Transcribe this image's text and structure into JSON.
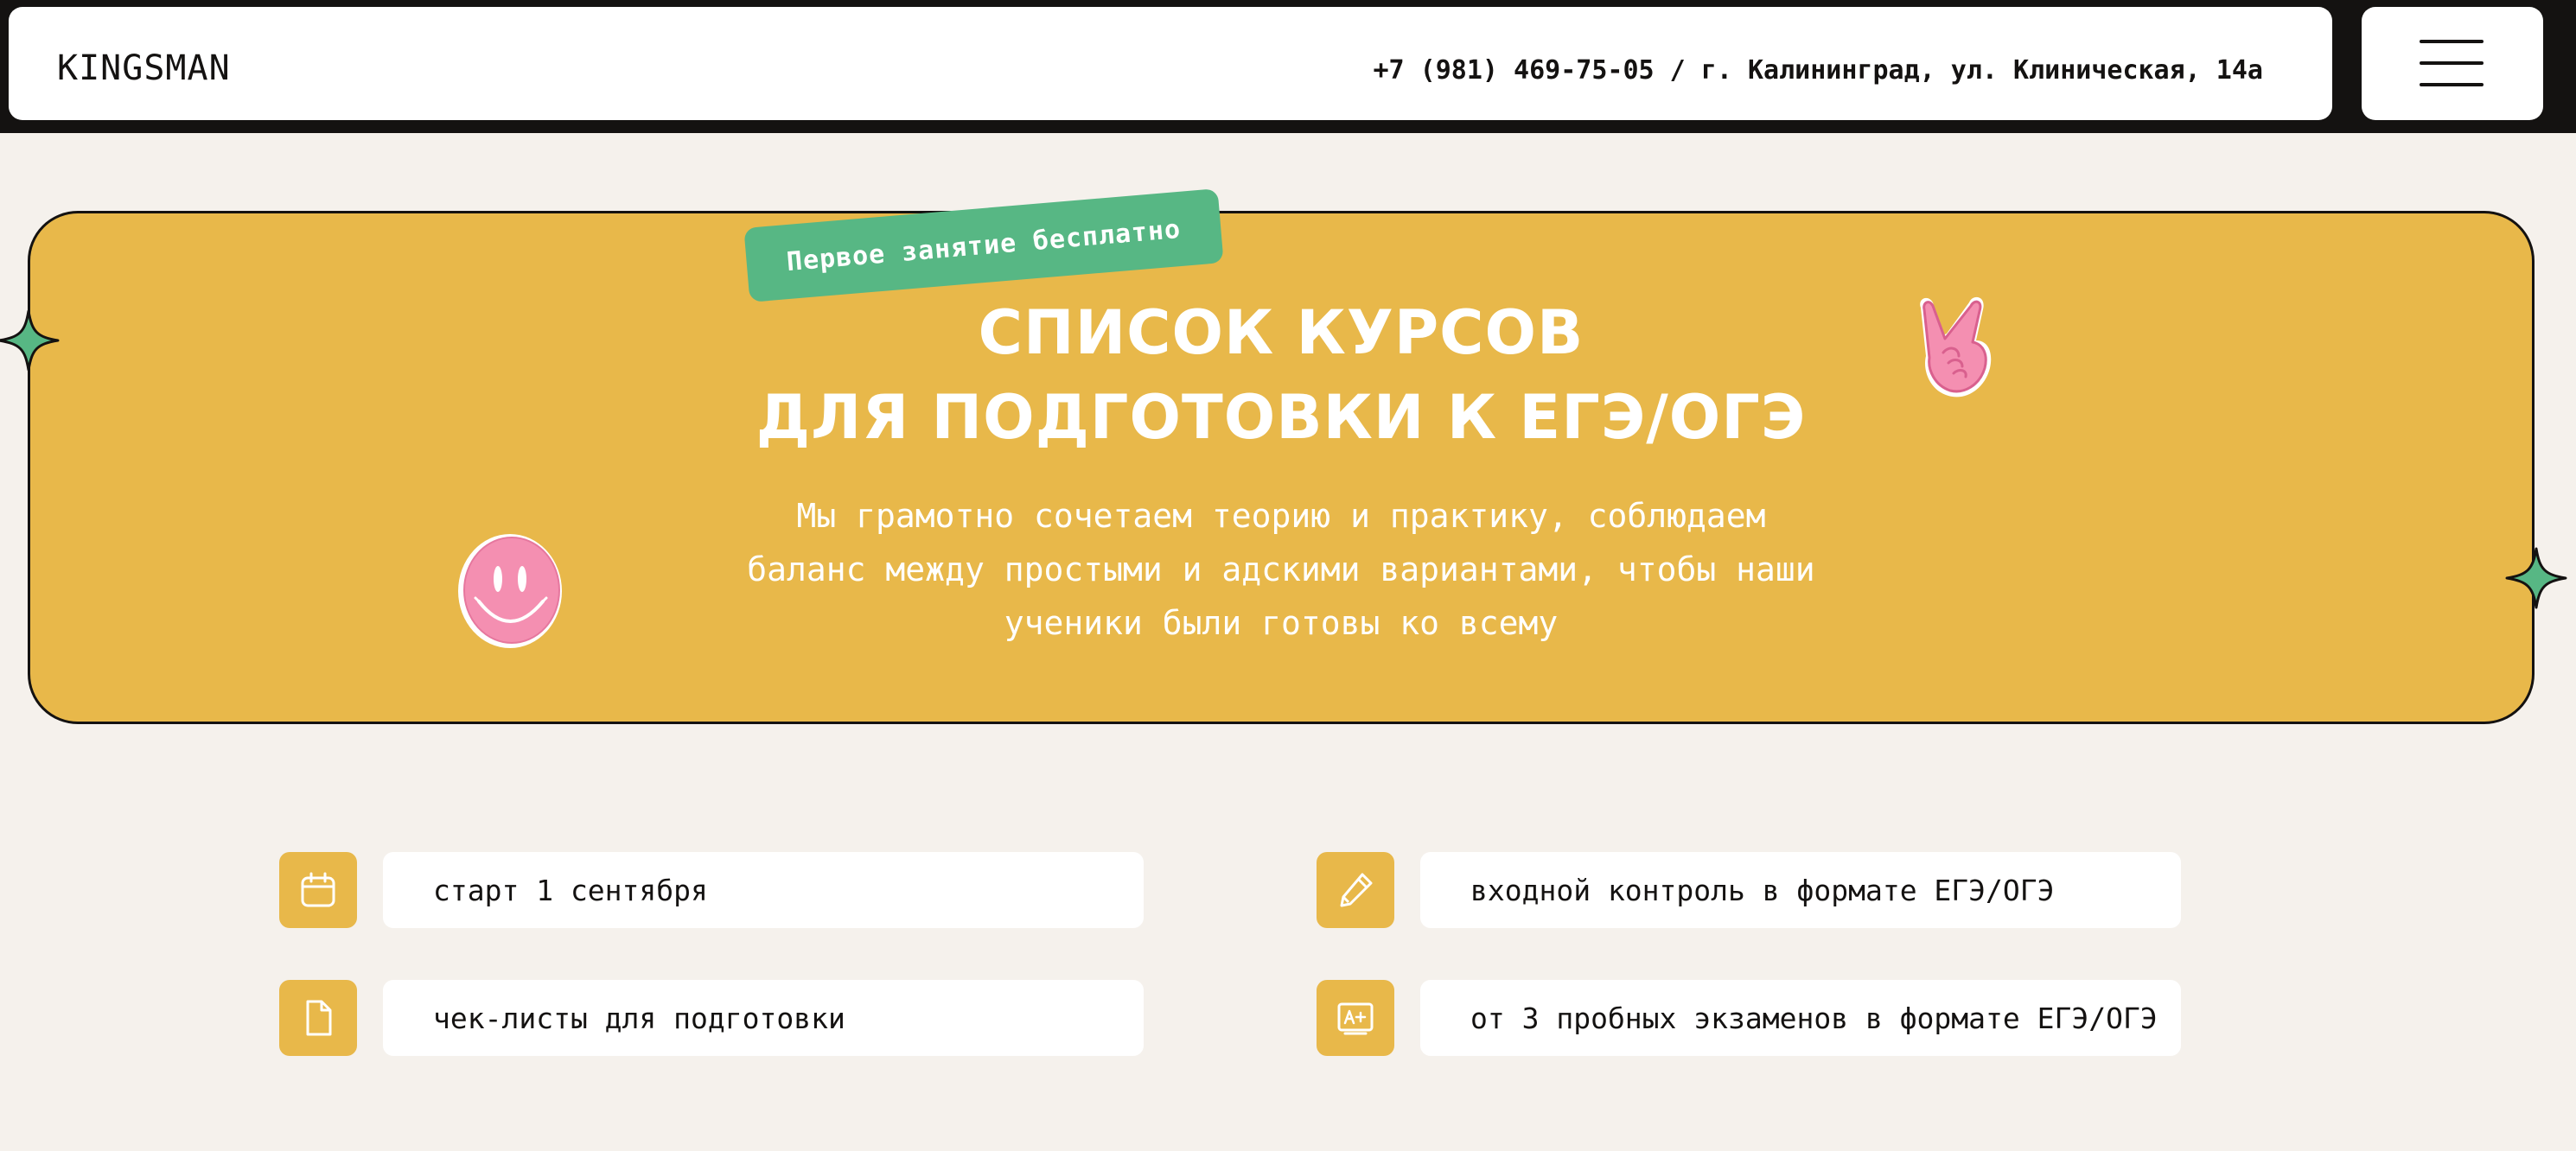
{
  "header": {
    "logo": "KINGSMAN",
    "contacts": "+7 (981) 469-75-05 / г. Калининград, ул. Клиническая, 14а",
    "menu_icon": "hamburger-icon"
  },
  "hero": {
    "badge": "Первое занятие бесплатно",
    "title_line1": "СПИСОК КУРСОВ",
    "title_line2": "ДЛЯ ПОДГОТОВКИ К ЕГЭ/ОГЭ",
    "text_line1": "Мы грамотно сочетаем теорию и практику, соблюдаем",
    "text_line2": "баланс между простыми и адскими вариантами, чтобы наши",
    "text_line3": "ученики были готовы ко всему",
    "stickers": [
      "smiley-sticker",
      "rock-hand-sticker"
    ]
  },
  "features": [
    {
      "icon": "calendar-icon",
      "text": "старт 1 сентября"
    },
    {
      "icon": "pencil-icon",
      "text": "входной контроль в формате ЕГЭ/ОГЭ"
    },
    {
      "icon": "document-icon",
      "text": "чек-листы для подготовки"
    },
    {
      "icon": "exam-grade-icon",
      "text": "от 3 пробных экзаменов в формате ЕГЭ/ОГЭ"
    }
  ],
  "colors": {
    "header_bg": "#141211",
    "page_bg": "#f5f1ec",
    "accent_yellow": "#e8b84a",
    "accent_green": "#57b784",
    "sticker_pink": "#f48fb1"
  }
}
